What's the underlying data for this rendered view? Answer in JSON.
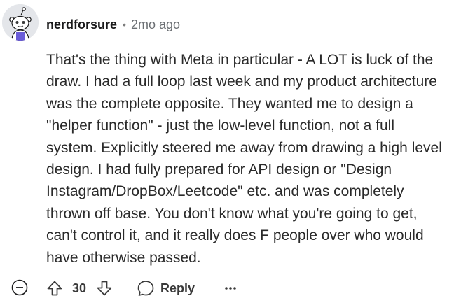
{
  "comment": {
    "username": "nerdforsure",
    "separator": "•",
    "timestamp": "2mo ago",
    "avatar_icon": "snoo-avatar-icon",
    "lines": [
      "That's the thing with Meta in particular - A LOT is luck of the",
      "draw. I had a full loop last week and my product architecture",
      "was the complete opposite. They wanted me to design a",
      "\"helper function\" - just the low-level function, not a full",
      "system. Explicitly steered me away from drawing a high level",
      "design. I had fully prepared for API design or \"Design",
      "Instagram/DropBox/Leetcode\" etc. and was completely",
      "thrown off base. You don't know what you're going to get,",
      "can't control it, and it really does F people over who would",
      "have otherwise passed."
    ]
  },
  "actions": {
    "collapse_icon": "collapse-minus-icon",
    "upvote_icon": "upvote-arrow-icon",
    "score": "30",
    "downvote_icon": "downvote-arrow-icon",
    "reply_icon": "chat-bubble-icon",
    "reply_label": "Reply",
    "more_icon": "ellipsis-icon"
  }
}
